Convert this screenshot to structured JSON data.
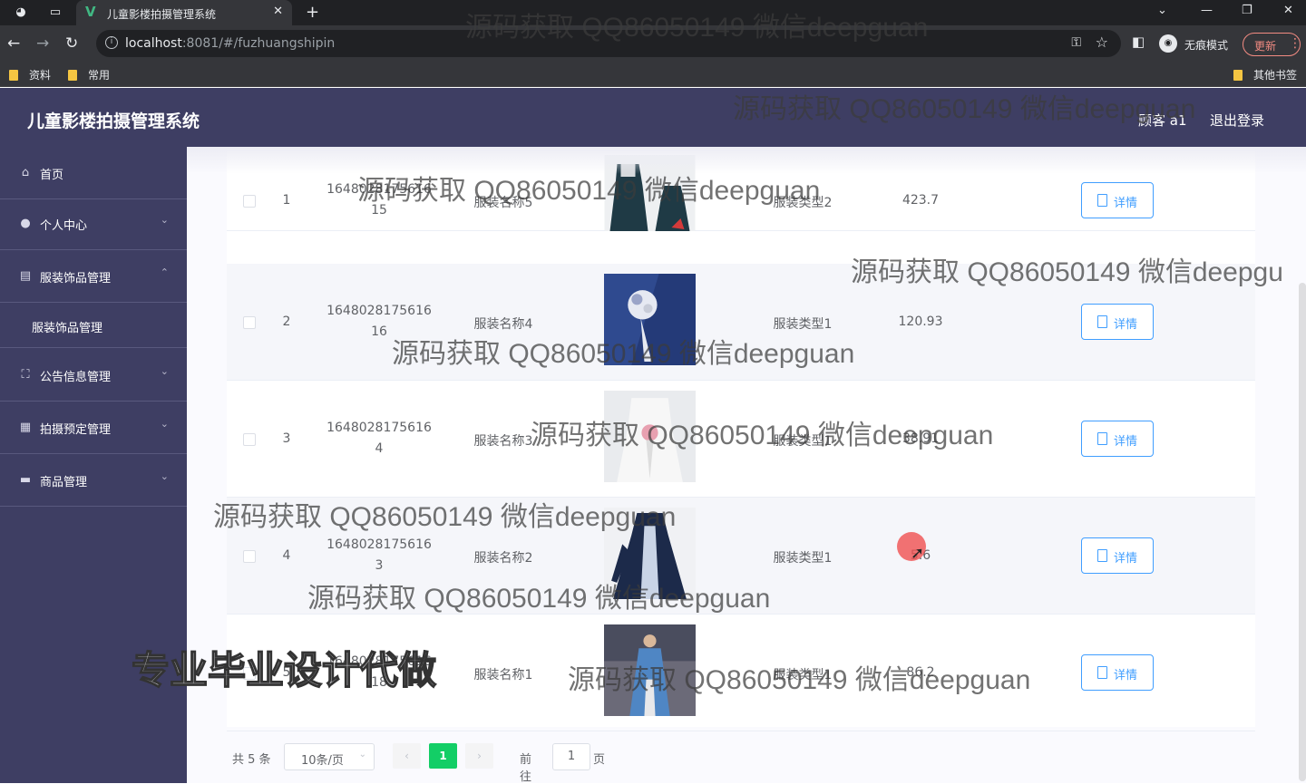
{
  "browser": {
    "tab_title": "儿童影楼拍摄管理系统",
    "tab_close": "✕",
    "new_tab": "+",
    "url_host": "localhost",
    "url_rest": ":8081/#/fuzhuangshipin",
    "incognito_label": "无痕模式",
    "update_label": "更新",
    "bookmarks": [
      "资料",
      "常用"
    ],
    "other_bookmarks": "其他书签"
  },
  "app": {
    "title": "儿童影楼拍摄管理系统",
    "user_label": "顾客 a1",
    "logout_label": "退出登录"
  },
  "sidebar": {
    "items": [
      {
        "label": "首页",
        "icon": "home-icon"
      },
      {
        "label": "个人中心",
        "icon": "user-icon"
      },
      {
        "label": "服装饰品管理",
        "icon": "clipboard-icon",
        "expanded": true
      },
      {
        "label": "公告信息管理",
        "icon": "frame-icon"
      },
      {
        "label": "拍摄预定管理",
        "icon": "grid-icon"
      },
      {
        "label": "商品管理",
        "icon": "product-icon"
      }
    ],
    "sub_item": "服装饰品管理"
  },
  "table": {
    "detail_label": "详情",
    "rows": [
      {
        "index": "1",
        "id_line1": "1648028175616",
        "id_line2": "15",
        "name": "服装名称5",
        "type": "服装类型2",
        "price": "423.7"
      },
      {
        "index": "2",
        "id_line1": "1648028175616",
        "id_line2": "16",
        "name": "服装名称4",
        "type": "服装类型1",
        "price": "120.93"
      },
      {
        "index": "3",
        "id_line1": "1648028175616",
        "id_line2": "4",
        "name": "服装名称3",
        "type": "服装类型1",
        "price": "38.91"
      },
      {
        "index": "4",
        "id_line1": "1648028175616",
        "id_line2": "3",
        "name": "服装名称2",
        "type": "服装类型1",
        "price": "5.6"
      },
      {
        "index": "5",
        "id_line1": "1648028175616",
        "id_line2": "18",
        "name": "服装名称1",
        "type": "服装类型1",
        "price": "86.2"
      }
    ]
  },
  "pager": {
    "total": "共 5 条",
    "page_size": "10条/页",
    "prev": "‹",
    "current": "1",
    "next": "›",
    "goto": "前往",
    "goto_value": "1",
    "page_suffix": "页"
  },
  "watermarks": {
    "text": "源码获取 QQ86050149 微信deepguan",
    "cut": "源码获取 QQ86050149 微信deepgu",
    "banner": "专业毕业设计代做"
  },
  "colors": {
    "header_bg": "#3e3e63",
    "accent": "#409eff",
    "pager_current": "#13ce66"
  }
}
